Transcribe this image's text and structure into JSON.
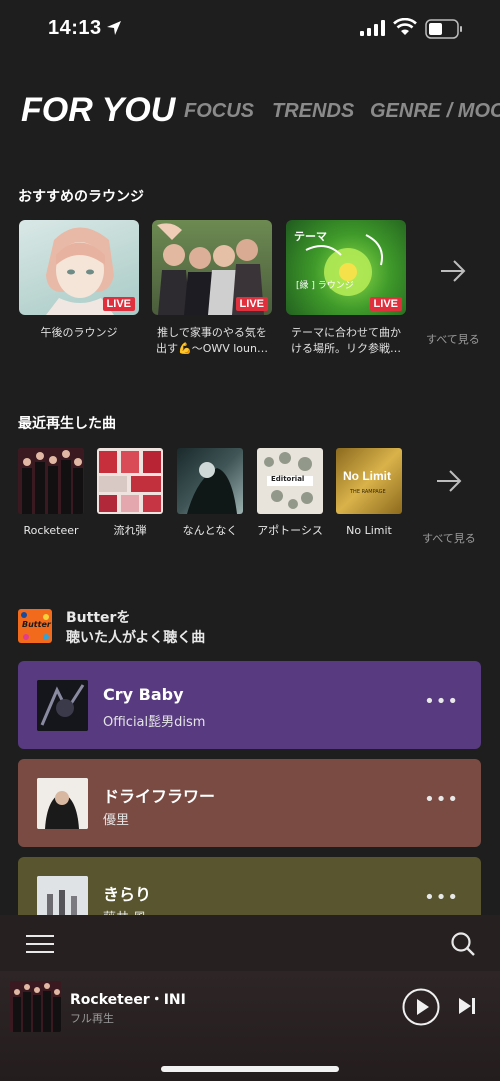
{
  "status": {
    "time": "14:13"
  },
  "tabs": [
    {
      "label": "FOR YOU",
      "active": true
    },
    {
      "label": "FOCUS"
    },
    {
      "label": "TRENDS"
    },
    {
      "label": "GENRE / MOOD"
    }
  ],
  "lounges": {
    "title": "おすすめのラウンジ",
    "items": [
      {
        "caption": "午後のラウンジ",
        "badge": "LIVE"
      },
      {
        "caption": "推しで家事のやる気を出す💪〜OWV loun…",
        "badge": "LIVE"
      },
      {
        "caption": "テーマに合わせて曲かける場所。リク参戦…",
        "badge": "LIVE",
        "thumb_text_1": "テーマ",
        "thumb_text_2": "[縁 ] ラウンジ"
      }
    ],
    "see_all": "すべて見る"
  },
  "recent": {
    "title": "最近再生した曲",
    "items": [
      {
        "caption": "Rocketeer"
      },
      {
        "caption": "流れ弾"
      },
      {
        "caption": "なんとなく"
      },
      {
        "caption": "アポトーシス",
        "thumb_text": "Editorial"
      },
      {
        "caption": "No Limit",
        "thumb_text": "No Limit",
        "thumb_text_2": "THE RAMPAGE"
      }
    ],
    "see_all": "すべて見る"
  },
  "butter": {
    "icon_text": "Butter",
    "title_line1": "Butterを",
    "title_line2": "聴いた人がよく聴く曲",
    "tracks": [
      {
        "title": "Cry Baby",
        "artist": "Official髭男dism",
        "bg": "#573a7f"
      },
      {
        "title": "ドライフラワー",
        "artist": "優里",
        "bg": "#7a4b43"
      },
      {
        "title": "きらり",
        "artist": "藤井 風",
        "bg": "#59562f"
      }
    ]
  },
  "player": {
    "title": "Rocketeer・INI",
    "subtitle": "フル再生"
  }
}
